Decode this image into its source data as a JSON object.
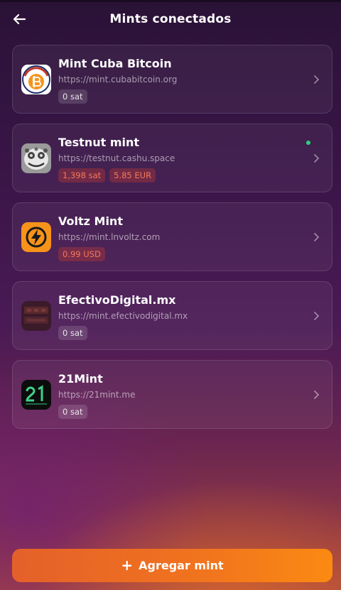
{
  "header": {
    "title": "Mints conectados",
    "back_icon": "arrow-left-icon"
  },
  "mints": [
    {
      "name": "Mint Cuba Bitcoin",
      "url": "https://mint.cubabitcoin.org",
      "badges": [
        "0 sat"
      ],
      "active": false,
      "logo": "cuba-bitcoin-logo"
    },
    {
      "name": "Testnut mint",
      "url": "https://testnut.cashu.space",
      "badges": [
        "1,398 sat",
        "5.85 EUR"
      ],
      "active": true,
      "logo": "testnut-logo"
    },
    {
      "name": "Voltz Mint",
      "url": "https://mint.lnvoltz.com",
      "badges": [
        "0.99 USD"
      ],
      "active": false,
      "logo": "voltz-logo"
    },
    {
      "name": "EfectivoDigital.mx",
      "url": "https://mint.efectivodigital.mx",
      "badges": [
        "0 sat"
      ],
      "active": false,
      "logo": "efectivo-digital-logo"
    },
    {
      "name": "21Mint",
      "url": "https://21mint.me",
      "badges": [
        "0 sat"
      ],
      "active": false,
      "logo": "21mint-logo"
    }
  ],
  "colors": {
    "accent": "#f1741e",
    "active_dot": "#2ad27a",
    "alt_badge_text": "#f27a5a"
  },
  "footer": {
    "add_label": "Agregar mint",
    "add_icon": "plus-icon"
  }
}
